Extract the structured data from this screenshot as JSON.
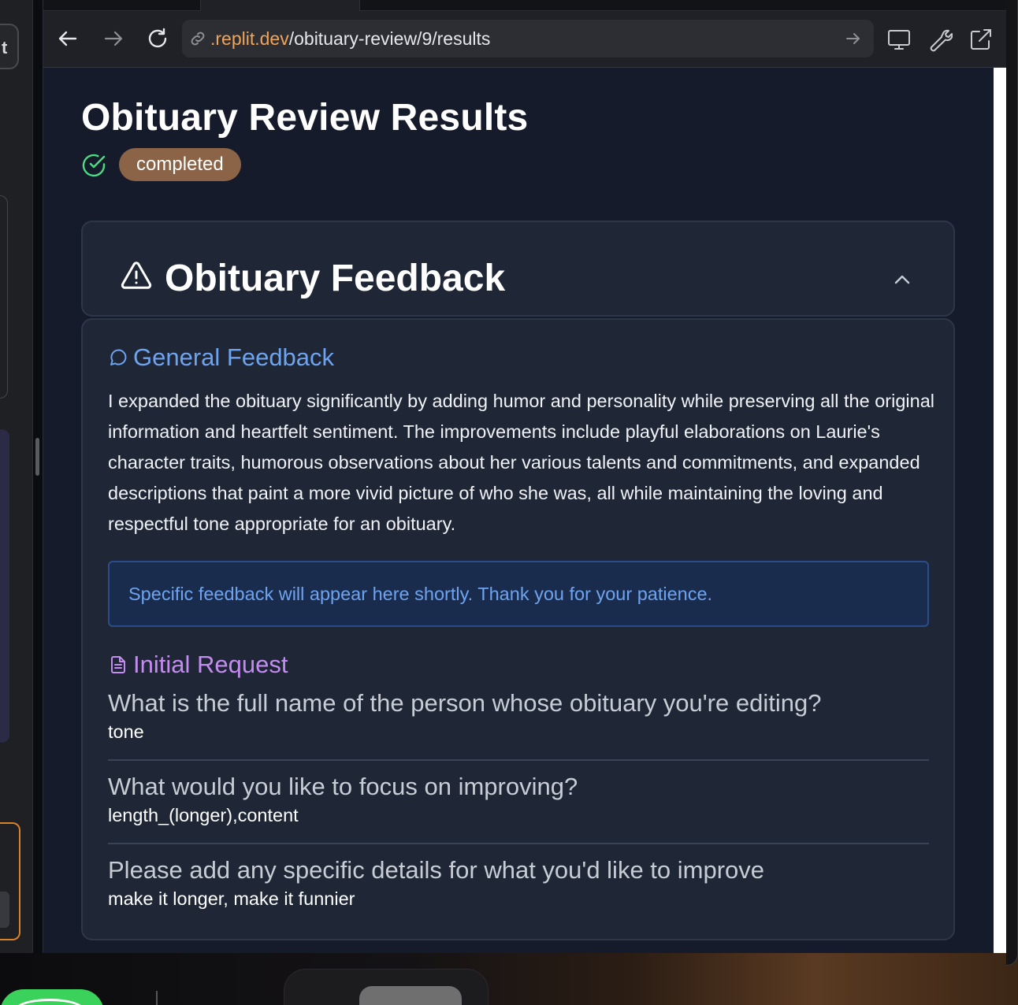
{
  "browser": {
    "url_domain": ".replit.dev",
    "url_path": "/obituary-review/9/results"
  },
  "left_panel": {
    "tab_letter": "t"
  },
  "page": {
    "title": "Obituary Review Results",
    "status": "completed"
  },
  "feedback_card": {
    "title": "Obituary Feedback",
    "general": {
      "heading": "General Feedback",
      "text": "I expanded the obituary significantly by adding humor and personality while preserving all the original information and heartfelt sentiment. The improvements include playful elaborations on Laurie's character traits, humorous observations about her various talents and commitments, and expanded descriptions that paint a more vivid picture of who she was, all while maintaining the loving and respectful tone appropriate for an obituary."
    },
    "notice": "Specific feedback will appear here shortly. Thank you for your patience.",
    "initial_request": {
      "heading": "Initial Request",
      "items": [
        {
          "question": "What is the full name of the person whose obituary you're editing?",
          "answer": "tone"
        },
        {
          "question": "What would you like to focus on improving?",
          "answer": "length_(longer),content"
        },
        {
          "question": "Please add any specific details for what you'd like to improve",
          "answer": "make it longer, make it funnier"
        }
      ]
    }
  },
  "colors": {
    "accent_blue": "#6ea3ef",
    "accent_purple": "#c48bf0",
    "status_badge": "#8b6448",
    "status_check": "#4ade80",
    "url_domain": "#f0a45a"
  },
  "icons": {
    "back": "arrow-left-icon",
    "forward": "arrow-right-icon",
    "reload": "reload-icon",
    "link": "link-icon",
    "go": "arrow-right-icon",
    "desktop": "monitor-icon",
    "devtools": "wrench-icon",
    "open_external": "external-link-icon",
    "status": "check-circle-icon",
    "card": "warning-triangle-icon",
    "collapse": "chevron-up-icon",
    "general": "message-circle-icon",
    "request": "document-icon"
  }
}
